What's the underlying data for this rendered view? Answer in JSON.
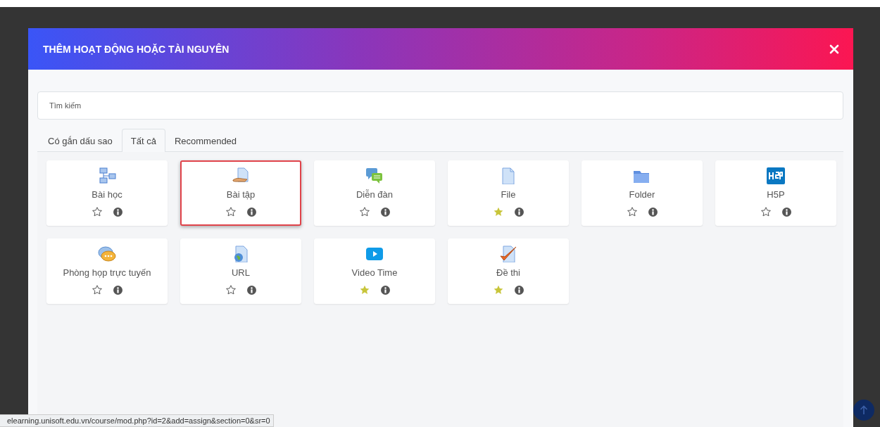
{
  "modal": {
    "title": "THÊM HOẠT ĐỘNG HOẶC TÀI NGUYÊN"
  },
  "search": {
    "placeholder": "Tìm kiếm"
  },
  "tabs": [
    {
      "label": "Có gắn dấu sao",
      "selected": false
    },
    {
      "label": "Tất cả",
      "selected": true
    },
    {
      "label": "Recommended",
      "selected": false
    }
  ],
  "activities": [
    {
      "label": "Bài học",
      "starred": false,
      "highlighted": false
    },
    {
      "label": "Bài tập",
      "starred": false,
      "highlighted": true
    },
    {
      "label": "Diễn đàn",
      "starred": false,
      "highlighted": false
    },
    {
      "label": "File",
      "starred": true,
      "highlighted": false
    },
    {
      "label": "Folder",
      "starred": false,
      "highlighted": false
    },
    {
      "label": "H5P",
      "starred": false,
      "highlighted": false
    },
    {
      "label": "Phòng họp trực tuyến",
      "starred": false,
      "highlighted": false
    },
    {
      "label": "URL",
      "starred": false,
      "highlighted": false
    },
    {
      "label": "Video Time",
      "starred": true,
      "highlighted": false
    },
    {
      "label": "Đề thi",
      "starred": true,
      "highlighted": false
    }
  ],
  "status_bar": {
    "url": "elearning.unisoft.edu.vn/course/mod.php?id=2&add=assign&section=0&sr=0"
  }
}
